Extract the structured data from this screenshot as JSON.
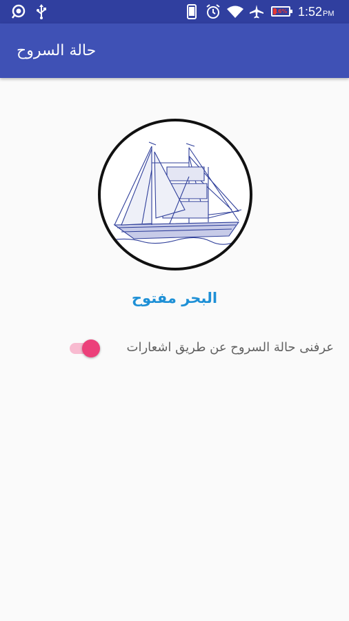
{
  "status_bar": {
    "icons": [
      "search-icon",
      "usb-icon",
      "phone-icon",
      "alarm-icon",
      "wifi-icon",
      "airplane-icon",
      "battery-icon"
    ],
    "battery_text": "16%",
    "battery_level": 0.16,
    "time": "1:52",
    "am_pm": "PM"
  },
  "app_bar": {
    "title": "حالة السروح"
  },
  "main": {
    "image": "ship-icon",
    "sea_status": "البحر مفتوح",
    "notify_label": "عرفنى حالة السروح عن طريق اشعارات",
    "notify_switch_on": true
  },
  "colors": {
    "status_bar": "#303f9f",
    "app_bar": "#3f51b5",
    "sea_status_text": "#1e90d6",
    "switch_thumb": "#ec407a",
    "switch_track": "#f8bbd0",
    "battery_low": "#e53935"
  }
}
